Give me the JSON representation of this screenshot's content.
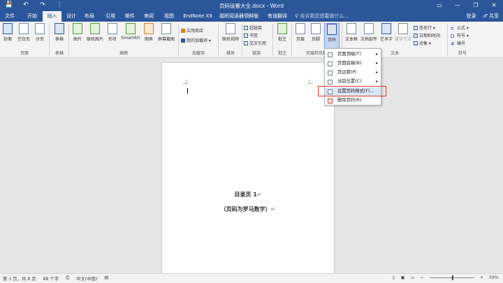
{
  "window": {
    "title": "页码设置大全.docx - Word",
    "qat": [
      "💾",
      "↶",
      "↷",
      "⋮"
    ],
    "controls": [
      "▭",
      "—",
      "❐",
      "✕"
    ]
  },
  "tabs": [
    "文件",
    "开始",
    "插入",
    "设计",
    "布局",
    "引用",
    "邮件",
    "审阅",
    "视图",
    "EndNote X9",
    "福昕阅读器领鲜版",
    "有道翻译"
  ],
  "active_tab": "插入",
  "tell_me": "♀ 告诉我您想要做什么...",
  "account": {
    "login": "登录",
    "share": "♂ 共享"
  },
  "ribbon": {
    "buttons": {
      "cover": "封面",
      "blank": "空白页",
      "pagebreak": "分页",
      "table": "表格",
      "picture": "图片",
      "online_picture": "联机图片",
      "shapes": "形状",
      "smartart": "SmartArt",
      "chart": "图表",
      "screenshot": "屏幕截图",
      "store": "应用商店",
      "my_addins": "我的加载项",
      "online_video": "联机视频",
      "hyperlink": "超链接",
      "bookmark": "书签",
      "crossref": "交叉引用",
      "comment": "批注",
      "header": "页眉",
      "footer": "页脚",
      "page_number": "页码",
      "textbox": "文本框",
      "quickparts": "文档部件",
      "wordart": "艺术字",
      "dropcap": "首字下沉",
      "signature": "签名行",
      "datetime": "日期和时间",
      "object": "对象",
      "equation": "公式",
      "symbol": "符号",
      "number": "编号"
    },
    "groups": {
      "pages": "页面",
      "tables": "表格",
      "illustrations": "插图",
      "addins": "加载项",
      "media": "媒体",
      "links": "链接",
      "comments": "批注",
      "header_footer": "页眉和页脚",
      "text": "文本",
      "symbols": "符号"
    }
  },
  "page_number_menu": {
    "items": [
      {
        "label": "页面顶端(T)",
        "submenu": true
      },
      {
        "label": "页面底端(B)",
        "submenu": true
      },
      {
        "label": "页边距(P)",
        "submenu": true
      },
      {
        "label": "当前位置(C)",
        "submenu": true
      },
      {
        "label": "设置页码格式(F)...",
        "submenu": false,
        "highlighted": true
      },
      {
        "label": "删除页码(R)",
        "submenu": false
      }
    ]
  },
  "document": {
    "line1": "目录页 1",
    "line2": "（页码为罗马数字）",
    "para_mark": "↵"
  },
  "status": {
    "page": "第 3 页，共 8 页",
    "words": "88 个字",
    "language": "中文(中国)",
    "zoom": "59%"
  },
  "colors": {
    "brand": "#2b579a",
    "highlight_box": "#e0352b"
  }
}
